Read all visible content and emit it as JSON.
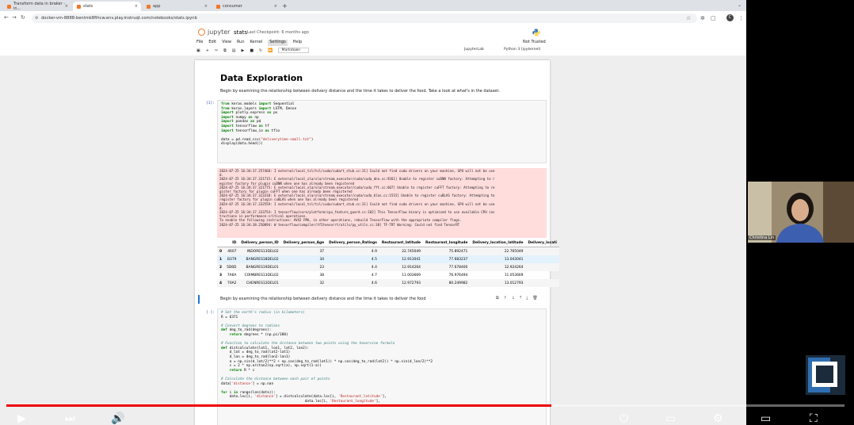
{
  "browser": {
    "tabs": [
      {
        "label": "Transform data in braker - in...",
        "active": false
      },
      {
        "label": "stats",
        "active": true
      },
      {
        "label": "app",
        "active": false
      },
      {
        "label": "consumer",
        "active": false
      }
    ],
    "new_tab": "+",
    "url": "docker-vm-8888-bentmk8fihcw.env.play.instruqt.com/notebooks/stats.ipynb",
    "profile_initial": "C"
  },
  "jupyter": {
    "logo_text": "jupyter",
    "notebook_name": "stats",
    "checkpoint": "Last Checkpoint: 6 months ago",
    "menu": [
      "File",
      "Edit",
      "View",
      "Run",
      "Kernel",
      "Settings",
      "Help"
    ],
    "active_menu": "Settings",
    "trust_status": "Not Trusted",
    "cell_type": "Markdown",
    "jupyterlab_link": "JupyterLab",
    "kernel": "Python 3 (ipykernel)"
  },
  "notebook": {
    "title": "Data Exploration",
    "intro": "Begin by examining the relationship between delivery distance and the time it takes to deliver the food. Take a look at what's in the dataset.",
    "cell1_prompt": "[1]:",
    "cell1_code": [
      [
        {
          "k": "kw",
          "t": "from"
        },
        {
          "t": " keras.models "
        },
        {
          "k": "kw",
          "t": "import"
        },
        {
          "t": " Sequential"
        }
      ],
      [
        {
          "k": "kw",
          "t": "from"
        },
        {
          "t": " keras.layers "
        },
        {
          "k": "kw",
          "t": "import"
        },
        {
          "t": " LSTM, Dense"
        }
      ],
      [
        {
          "k": "kw",
          "t": "import"
        },
        {
          "t": " plotly.express "
        },
        {
          "k": "kw",
          "t": "as"
        },
        {
          "t": " px"
        }
      ],
      [
        {
          "k": "kw",
          "t": "import"
        },
        {
          "t": " numpy "
        },
        {
          "k": "kw",
          "t": "as"
        },
        {
          "t": " np"
        }
      ],
      [
        {
          "k": "kw",
          "t": "import"
        },
        {
          "t": " pandas "
        },
        {
          "k": "kw",
          "t": "as"
        },
        {
          "t": " pd"
        }
      ],
      [
        {
          "k": "kw",
          "t": "import"
        },
        {
          "t": " tensorflow "
        },
        {
          "k": "kw",
          "t": "as"
        },
        {
          "t": " tf"
        }
      ],
      [
        {
          "k": "kw",
          "t": "import"
        },
        {
          "t": " tensorflow_io "
        },
        {
          "k": "kw",
          "t": "as"
        },
        {
          "t": " tfio"
        }
      ],
      [
        {
          "t": ""
        }
      ],
      [
        {
          "t": "data = pd.read_csv("
        },
        {
          "k": "str",
          "t": "\"deliverytime-small.txt\""
        },
        {
          "t": ")"
        }
      ],
      [
        {
          "t": "display(data.head())"
        }
      ]
    ],
    "stderr": [
      "2024-07-25 16:34:37.257468: I external/local_tsl/tsl/cuda/cudart_stub.cc:31] Could not find cuda drivers on your machine, GPU will not be use",
      "d.",
      "2024-07-25 16:34:37.321715: E external/local_xla/xla/stream_executor/cuda/cuda_dnn.cc:9261] Unable to register cuDNN factory: Attempting to r",
      "egister factory for plugin cuDNN when one has already been registered",
      "2024-07-25 16:34:37.321775: E external/local_xla/xla/stream_executor/cuda/cuda_fft.cc:607] Unable to register cuFFT factory: Attempting to re",
      "gister factory for plugin cuFFT when one has already been registered",
      "2024-07-25 16:34:37.323318: E external/local_xla/xla/stream_executor/cuda/cuda_blas.cc:1515] Unable to register cuBLAS factory: Attempting to",
      "register factory for plugin cuBLAS when one has already been registered",
      "2024-07-25 16:34:37.332559: I external/local_tsl/tsl/cuda/cudart_stub.cc:31] Could not find cuda drivers on your machine, GPU will not be use",
      "d.",
      "2024-07-25 16:34:37.333754: I tensorflow/core/platform/cpu_feature_guard.cc:182] This TensorFlow binary is optimized to use available CPU ins",
      "tructions in performance-critical operations.",
      "To enable the following instructions: AVX2 FMA, in other operations, rebuild TensorFlow with the appropriate compiler flags.",
      "2024-07-25 16:34:38.250894: W tensorflow/compiler/tf2tensorrt/utils/py_utils.cc:38] TF-TRT Warning: Could not find TensorRT"
    ],
    "table": {
      "headers": [
        "",
        "ID",
        "Delivery_person_ID",
        "Delivery_person_Age",
        "Delivery_person_Ratings",
        "Restaurant_latitude",
        "Restaurant_longitude",
        "Delivery_location_latitude",
        "Delivery_locati"
      ],
      "rows": [
        [
          "0",
          "4607",
          "INDORES13DEL02",
          "37",
          "4.9",
          "22.745049",
          "75.892471",
          "22.765049",
          ""
        ],
        [
          "1",
          "B379",
          "BANGRES18DEL02",
          "34",
          "4.5",
          "12.913041",
          "77.683237",
          "13.043041",
          ""
        ],
        [
          "2",
          "5D6D",
          "BANGRES19DEL01",
          "23",
          "4.4",
          "12.914264",
          "77.678400",
          "12.924264",
          ""
        ],
        [
          "3",
          "7A6A",
          "COIMBRES13DEL02",
          "38",
          "4.7",
          "11.003669",
          "76.976494",
          "11.053669",
          ""
        ],
        [
          "4",
          "70A2",
          "CHENRES12DEL01",
          "32",
          "4.6",
          "12.972793",
          "80.249982",
          "13.012793",
          ""
        ]
      ]
    },
    "md_cell": "Begin by examining the relationship between delivery distance and the time it takes to deliver the food",
    "cell2_prompt": "[ ]:",
    "cell2_code": [
      [
        {
          "k": "cm",
          "t": "# Set the earth's radius (in kilometers)"
        }
      ],
      [
        {
          "t": "R = 6371"
        }
      ],
      [
        {
          "t": ""
        }
      ],
      [
        {
          "k": "cm",
          "t": "# Convert degrees to radians"
        }
      ],
      [
        {
          "k": "kw",
          "t": "def"
        },
        {
          "t": " deg_to_rad(degrees):"
        }
      ],
      [
        {
          "t": "    "
        },
        {
          "k": "kw",
          "t": "return"
        },
        {
          "t": " degrees * (np.pi/180)"
        }
      ],
      [
        {
          "t": ""
        }
      ],
      [
        {
          "k": "cm",
          "t": "# Function to calculate the distance between two points using the haversine formula"
        }
      ],
      [
        {
          "k": "kw",
          "t": "def"
        },
        {
          "t": " distcalculate(lat1, lon1, lat2, lon2):"
        }
      ],
      [
        {
          "t": "    d_lat = deg_to_rad(lat2-lat1)"
        }
      ],
      [
        {
          "t": "    d_lon = deg_to_rad(lon2-lon1)"
        }
      ],
      [
        {
          "t": "    a = np.sin(d_lat/2)**2 + np.cos(deg_to_rad(lat1)) * np.cos(deg_to_rad(lat2)) * np.sin(d_lon/2)**2"
        }
      ],
      [
        {
          "t": "    c = 2 * np.arctan2(np.sqrt(a), np.sqrt(1-a))"
        }
      ],
      [
        {
          "t": "    "
        },
        {
          "k": "kw",
          "t": "return"
        },
        {
          "t": " R * c"
        }
      ],
      [
        {
          "t": ""
        }
      ],
      [
        {
          "k": "cm",
          "t": "# Calculate the distance between each pair of points"
        }
      ],
      [
        {
          "t": "data["
        },
        {
          "k": "str",
          "t": "'distance'"
        },
        {
          "t": "] = np.nan"
        }
      ],
      [
        {
          "t": ""
        }
      ],
      [
        {
          "k": "kw",
          "t": "for"
        },
        {
          "t": " i "
        },
        {
          "k": "kw",
          "t": "in"
        },
        {
          "t": " range(len(data)):"
        }
      ],
      [
        {
          "t": "    data.loc[i, "
        },
        {
          "k": "str",
          "t": "'distance'"
        },
        {
          "t": "] = distcalculate(data.loc[i, "
        },
        {
          "k": "str",
          "t": "'Restaurant_latitude'"
        },
        {
          "t": "],"
        }
      ],
      [
        {
          "t": "                                        data.loc[i, "
        },
        {
          "k": "str",
          "t": "'Restaurant_longitude'"
        },
        {
          "t": "],"
        }
      ]
    ]
  },
  "video": {
    "progress": 0.65,
    "presenter_name": "Christina Lin"
  },
  "colors": {
    "accent": "#f37726",
    "progress": "#ee0000",
    "selected_cell": "#1976d2"
  }
}
